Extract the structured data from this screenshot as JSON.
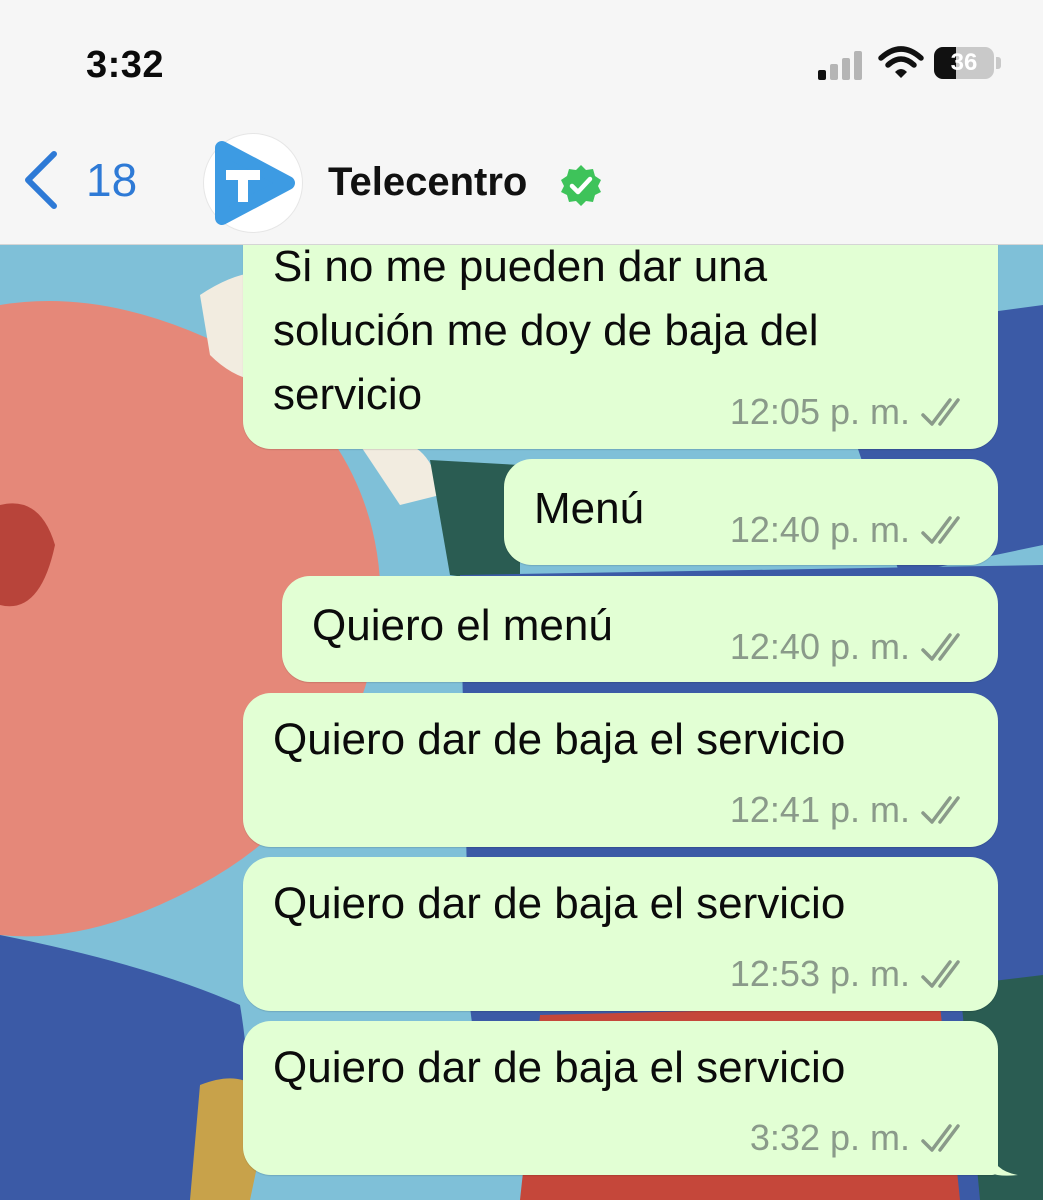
{
  "status_bar": {
    "time": "3:32",
    "battery_level": "36",
    "battery_fraction": 0.36,
    "icons": [
      "signal-icon",
      "wifi-icon",
      "battery-icon"
    ]
  },
  "header": {
    "back_count": "18",
    "contact_name": "Telecentro",
    "verified": true,
    "colors": {
      "accent": "#2e7ad6",
      "verified": "#3ec35a",
      "logo": "#3d9be3"
    }
  },
  "messages": [
    {
      "lines": [
        "Si no me pueden dar una",
        "solución me doy de baja del",
        "servicio"
      ],
      "time": "12:05 p. m."
    },
    {
      "lines": [
        "Menú"
      ],
      "time": "12:40 p. m."
    },
    {
      "lines": [
        "Quiero el menú"
      ],
      "time": "12:40 p. m."
    },
    {
      "lines": [
        "Quiero dar de baja el servicio"
      ],
      "time": "12:41 p. m."
    },
    {
      "lines": [
        "Quiero dar de baja el servicio"
      ],
      "time": "12:53 p. m."
    },
    {
      "lines": [
        "Quiero dar de baja el servicio"
      ],
      "time": "3:32 p. m."
    }
  ],
  "colors": {
    "outgoing_bubble": "#e2ffd4",
    "timestamp": "#8a9a8a"
  }
}
